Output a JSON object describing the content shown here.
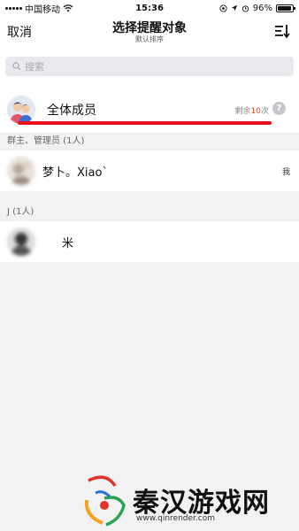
{
  "status": {
    "carrier": "中国移动",
    "time": "15:36",
    "battery": "96%",
    "battery_level": 0.96
  },
  "nav": {
    "cancel": "取消",
    "title": "选择提醒对象",
    "subtitle": "默认排序",
    "sort_icon": "sort-icon"
  },
  "search": {
    "placeholder": "搜索",
    "icon": "search-icon"
  },
  "all_members": {
    "label": "全体成员",
    "remain_prefix": "剩余",
    "remain_count": "10",
    "remain_suffix": "次",
    "help": "?"
  },
  "sections": [
    {
      "header": "群主、管理员 (1人)",
      "members": [
        {
          "name": "梦卜。Xiao`",
          "tag": "我"
        }
      ]
    },
    {
      "header": "J (1人)",
      "members": [
        {
          "name": "米",
          "tag": ""
        }
      ]
    }
  ],
  "watermark": {
    "text": "秦汉游戏网",
    "url": "www.qinrender.com"
  },
  "colors": {
    "accent_red": "#e8101b",
    "count_red": "#e8452b"
  }
}
